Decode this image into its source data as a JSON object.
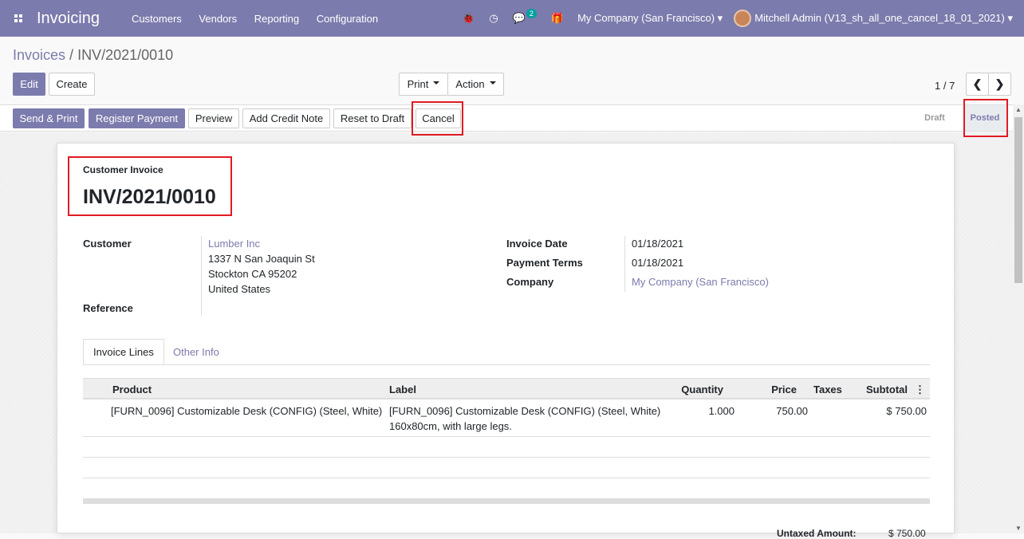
{
  "navbar": {
    "app_title": "Invoicing",
    "menu": [
      "Customers",
      "Vendors",
      "Reporting",
      "Configuration"
    ],
    "chat_badge": "2",
    "company": "My Company (San Francisco)",
    "user": "Mitchell Admin (V13_sh_all_one_cancel_18_01_2021)"
  },
  "breadcrumb": {
    "parent": "Invoices",
    "separator": " / ",
    "current": "INV/2021/0010"
  },
  "control": {
    "edit": "Edit",
    "create": "Create",
    "print": "Print",
    "action": "Action",
    "pager": "1 / 7"
  },
  "statusbar": {
    "buttons": [
      "Send & Print",
      "Register Payment",
      "Preview",
      "Add Credit Note",
      "Reset to Draft",
      "Cancel"
    ],
    "stages": [
      "Draft",
      "Posted"
    ],
    "active_stage": "Posted"
  },
  "invoice": {
    "type_label": "Customer Invoice",
    "number": "INV/2021/0010",
    "customer_label": "Customer",
    "customer_name": "Lumber Inc",
    "address": [
      "1337 N San Joaquin St",
      "Stockton CA 95202",
      "United States"
    ],
    "reference_label": "Reference",
    "invoice_date_label": "Invoice Date",
    "invoice_date": "01/18/2021",
    "payment_terms_label": "Payment Terms",
    "payment_terms": "01/18/2021",
    "company_label": "Company",
    "company": "My Company (San Francisco)"
  },
  "tabs": [
    "Invoice Lines",
    "Other Info"
  ],
  "lines": {
    "headers": [
      "Product",
      "Label",
      "Quantity",
      "Price",
      "Taxes",
      "Subtotal"
    ],
    "rows": [
      {
        "product": "[FURN_0096] Customizable Desk (CONFIG) (Steel, White)",
        "label": "[FURN_0096] Customizable Desk (CONFIG) (Steel, White)",
        "label2": "160x80cm, with large legs.",
        "quantity": "1.000",
        "price": "750.00",
        "taxes": "",
        "subtotal": "$ 750.00"
      }
    ]
  },
  "totals": {
    "untaxed_label": "Untaxed Amount:",
    "untaxed_value": "$ 750.00"
  }
}
